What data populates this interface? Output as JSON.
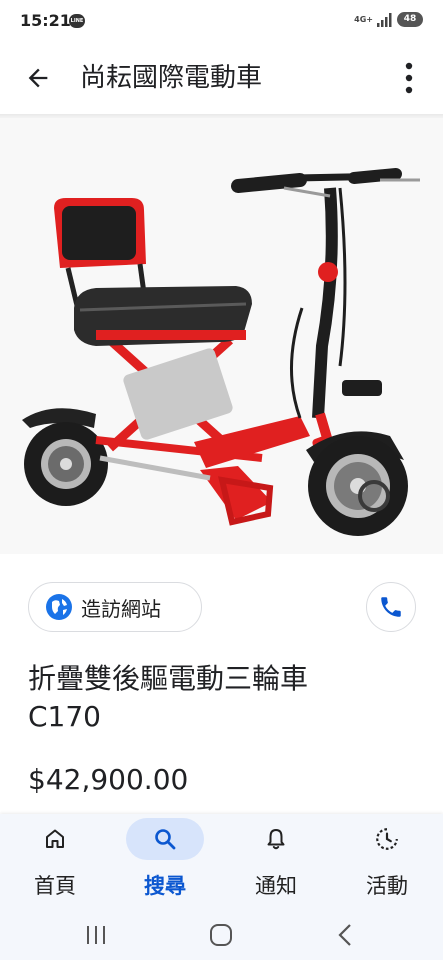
{
  "status_bar": {
    "time": "15:21",
    "line_badge": "LINE",
    "network": "4G+",
    "battery": "48"
  },
  "app_bar": {
    "title": "尚耘國際電動車"
  },
  "actions": {
    "visit_label": "造訪網站"
  },
  "product": {
    "name_line1": "折疊雙後驅電動三輪車",
    "name_line2": "C170",
    "price": "$42,900.00"
  },
  "bottom_nav": {
    "items": [
      {
        "label": "首頁",
        "icon": "home-icon"
      },
      {
        "label": "搜尋",
        "icon": "search-icon",
        "active": true
      },
      {
        "label": "通知",
        "icon": "bell-icon"
      },
      {
        "label": "活動",
        "icon": "activity-icon"
      }
    ]
  },
  "colors": {
    "accent": "#0b57d0",
    "active_pill": "#d7e4fb",
    "scooter_red": "#e02020"
  }
}
